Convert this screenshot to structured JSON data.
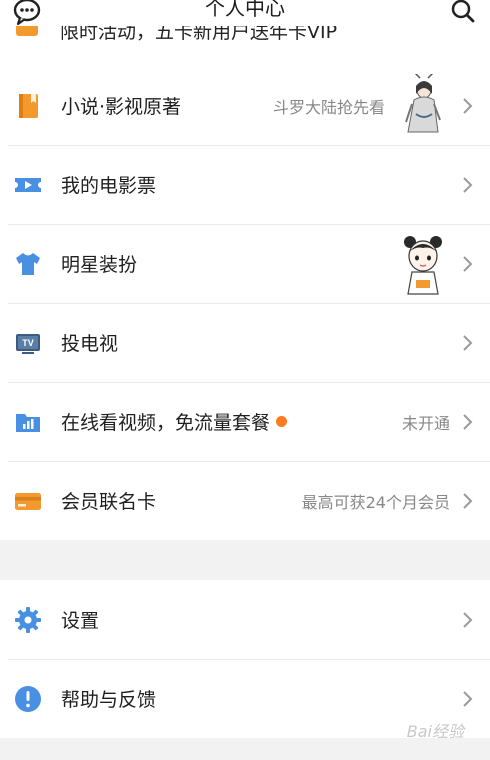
{
  "header": {
    "title": "个人中心",
    "chat_icon": "chat-bubble-icon",
    "search_icon": "search-icon"
  },
  "cutoff": {
    "text": "限时活动，五卡新用户送年卡VIP"
  },
  "menu": [
    {
      "label": "小说·影视原著",
      "sub": "斗罗大陆抢先看",
      "icon": "book-icon",
      "color": "#f39a2e"
    },
    {
      "label": "我的电影票",
      "sub": "",
      "icon": "ticket-icon",
      "color": "#4a90e2"
    },
    {
      "label": "明星装扮",
      "sub": "",
      "icon": "tshirt-icon",
      "color": "#4a90e2"
    },
    {
      "label": "投电视",
      "sub": "",
      "icon": "tv-icon",
      "color": "#3d5a80"
    },
    {
      "label": "在线看视频，免流量套餐",
      "sub": "未开通",
      "icon": "folder-chart-icon",
      "color": "#4a90e2"
    },
    {
      "label": "会员联名卡",
      "sub": "最高可获24个月会员",
      "icon": "card-icon",
      "color": "#f39a2e"
    }
  ],
  "settings": [
    {
      "label": "设置",
      "icon": "gear-icon",
      "color": "#4a90e2"
    },
    {
      "label": "帮助与反馈",
      "icon": "exclamation-icon",
      "color": "#4a90e2"
    }
  ],
  "watermark": "Bai经验"
}
